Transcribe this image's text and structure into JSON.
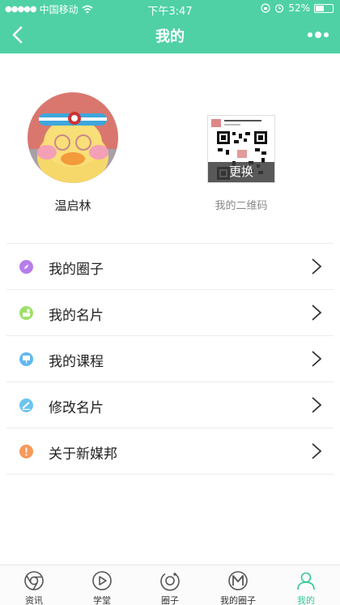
{
  "status_bar": {
    "carrier": "中国移动",
    "time": "下午3:47",
    "battery_percent": "52%",
    "battery_level": 0.52
  },
  "navbar": {
    "title": "我的",
    "back_icon": "chevron-left-icon",
    "more_icon": "more-dots-icon"
  },
  "profile": {
    "username": "温启林",
    "qr_change_label": "更换",
    "qr_caption": "我的二维码",
    "qr_card_title": "Youth in the capital"
  },
  "menu": [
    {
      "label": "我的圈子",
      "icon": "compass-icon",
      "color": "#b77de9"
    },
    {
      "label": "我的名片",
      "icon": "card-icon",
      "color": "#9ee06a"
    },
    {
      "label": "我的课程",
      "icon": "presentation-icon",
      "color": "#61b8f0"
    },
    {
      "label": "修改名片",
      "icon": "edit-icon",
      "color": "#6cc4ee"
    },
    {
      "label": "关于新媒邦",
      "icon": "exclamation-icon",
      "color": "#f7995a"
    }
  ],
  "tabs": [
    {
      "label": "资讯",
      "icon": "news-icon",
      "active": false
    },
    {
      "label": "学堂",
      "icon": "play-icon",
      "active": false
    },
    {
      "label": "圈子",
      "icon": "circle-icon",
      "active": false
    },
    {
      "label": "我的圈子",
      "icon": "my-circle-icon",
      "active": false
    },
    {
      "label": "我的",
      "icon": "person-icon",
      "active": true
    }
  ],
  "colors": {
    "accent": "#4fd1a5",
    "active_tab": "#35c996"
  }
}
